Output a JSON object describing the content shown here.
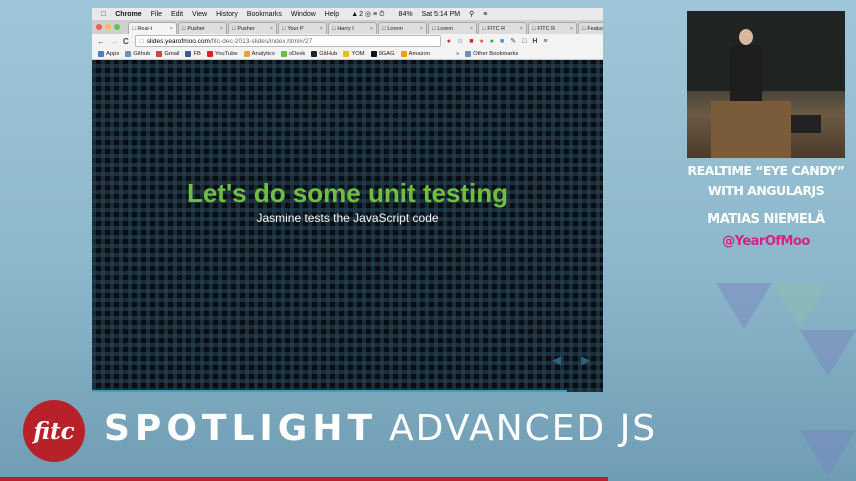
{
  "menubar": {
    "apple": "",
    "items": [
      "Chrome",
      "File",
      "Edit",
      "View",
      "History",
      "Bookmarks",
      "Window",
      "Help"
    ],
    "status": "2",
    "battery": "84%",
    "clock": "Sat 5:14 PM"
  },
  "tabs": [
    {
      "label": "Real-t",
      "active": true
    },
    {
      "label": "Pusher",
      "active": false
    },
    {
      "label": "Pusher",
      "active": false
    },
    {
      "label": "Your P",
      "active": false
    },
    {
      "label": "Harry I",
      "active": false
    },
    {
      "label": "Lorem",
      "active": false
    },
    {
      "label": "Lorem",
      "active": false
    },
    {
      "label": "FITC R",
      "active": false
    },
    {
      "label": "FITC R",
      "active": false
    },
    {
      "label": "Featur",
      "active": false
    }
  ],
  "toolbar": {
    "back": "←",
    "forward": "→",
    "reload": "C",
    "url_host": "slides.yearofmoo.com",
    "url_path": "/fitc-dec-2013-slides/index.html#/27"
  },
  "bookmarks": [
    {
      "label": "Apps",
      "color": "#4a7bd0"
    },
    {
      "label": "Github",
      "color": "#6a8fb8"
    },
    {
      "label": "Gmail",
      "color": "#d44638"
    },
    {
      "label": "FB",
      "color": "#3b5998"
    },
    {
      "label": "YouTube",
      "color": "#e02020"
    },
    {
      "label": "Analytics",
      "color": "#f0a030"
    },
    {
      "label": "oDesk",
      "color": "#6cbf3a"
    },
    {
      "label": "GitHub",
      "color": "#222222"
    },
    {
      "label": "YOM",
      "color": "#e6c200"
    },
    {
      "label": "9GAG",
      "color": "#111111"
    },
    {
      "label": "Amazon",
      "color": "#ff9900"
    }
  ],
  "bookmarks_more": "»",
  "other_bookmarks": "Other Bookmarks",
  "slide": {
    "title": "Let's do some unit testing",
    "subtitle": "Jasmine tests the JavaScript code",
    "progress": 0.93
  },
  "talk": {
    "line1": "REALTIME “EYE CANDY”",
    "line2": "WITH ANGULARJS",
    "speaker": "MATIAS NIEMELÄ",
    "handle": "@YearOfMoo"
  },
  "brand": {
    "logo": "fitc",
    "word1": "SPOTLIGHT",
    "word2": "ADVANCED JS"
  },
  "colors": {
    "slide_title": "#6fbe3f",
    "handle": "#d6218a",
    "brand_red": "#b8202a"
  }
}
